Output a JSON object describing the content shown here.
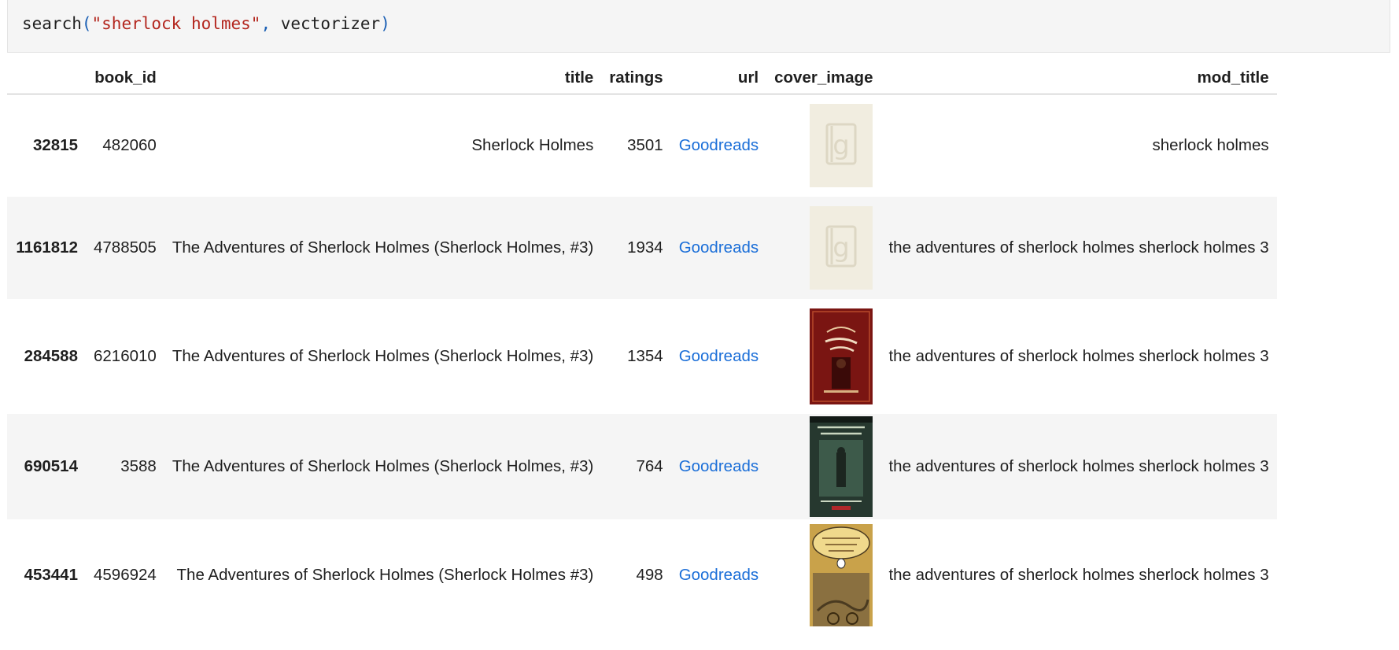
{
  "code": {
    "func": "search",
    "open_paren": "(",
    "arg_string": "\"sherlock holmes\"",
    "comma": ",",
    "arg_var": " vectorizer",
    "close_paren": ")"
  },
  "table": {
    "columns": [
      "",
      "book_id",
      "title",
      "ratings",
      "url",
      "cover_image",
      "mod_title"
    ],
    "rows": [
      {
        "index": "32815",
        "book_id": "482060",
        "title": "Sherlock Holmes",
        "ratings": "3501",
        "url": "Goodreads",
        "cover_icon": "goodreads-placeholder-icon",
        "mod_title": "sherlock holmes"
      },
      {
        "index": "1161812",
        "book_id": "4788505",
        "title": "The Adventures of Sherlock Holmes (Sherlock Holmes, #3)",
        "ratings": "1934",
        "url": "Goodreads",
        "cover_icon": "goodreads-placeholder-icon",
        "mod_title": "the adventures of sherlock holmes sherlock holmes 3"
      },
      {
        "index": "284588",
        "book_id": "6216010",
        "title": "The Adventures of Sherlock Holmes (Sherlock Holmes, #3)",
        "ratings": "1354",
        "url": "Goodreads",
        "cover_icon": "red-book-cover-icon",
        "mod_title": "the adventures of sherlock holmes sherlock holmes 3"
      },
      {
        "index": "690514",
        "book_id": "3588",
        "title": "The Adventures of Sherlock Holmes (Sherlock Holmes, #3)",
        "ratings": "764",
        "url": "Goodreads",
        "cover_icon": "green-book-cover-icon",
        "mod_title": "the adventures of sherlock holmes sherlock holmes 3"
      },
      {
        "index": "453441",
        "book_id": "4596924",
        "title": "The Adventures of Sherlock Holmes (Sherlock Holmes #3)",
        "ratings": "498",
        "url": "Goodreads",
        "cover_icon": "penguin-book-cover-icon",
        "mod_title": "the adventures of sherlock holmes sherlock holmes 3"
      }
    ]
  },
  "colors": {
    "link": "#1a6ed8",
    "code_string": "#b3261e",
    "code_paren": "#1a5fb4",
    "row_stripe": "#f5f5f5"
  }
}
